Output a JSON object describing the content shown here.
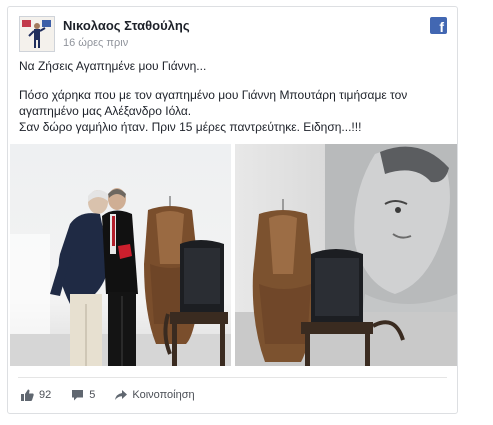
{
  "post": {
    "author": "Νικολαος Σταθούλης",
    "time": "16 ώρες πριν",
    "lines": [
      "Να Ζήσεις Αγαπημένε μου Γιάννη...",
      "Πόσο χάρηκα που με τον αγαπημένο μου Γιάννη Μπουτάρη τιμήσαμε τον",
      "αγαπημένο μας Αλέξανδρο Ιόλα.",
      "Σαν δώρο γαμήλιο ήταν. Πριν 15 μέρες παντρεύτηκε. Ειδηση...!!!"
    ]
  },
  "stats": {
    "likes": "92",
    "comments": "5",
    "share_label": "Κοινοποίηση"
  },
  "icons": {
    "brand": "facebook-icon",
    "like": "thumbs-up-icon",
    "comment": "comment-bubble-icon",
    "share": "share-arrow-icon"
  },
  "colors": {
    "facebook_blue": "#4267b2",
    "secondary_text": "#90949c"
  }
}
